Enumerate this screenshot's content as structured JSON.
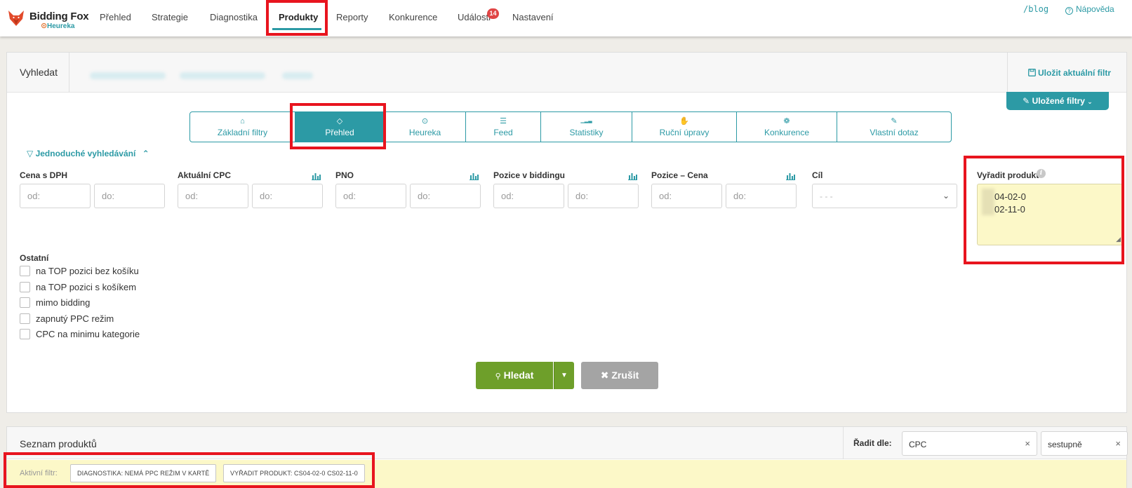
{
  "app": {
    "brand": "Bidding Fox",
    "brand_sub": "Heureka",
    "colors": {
      "accent": "#2c9aa5",
      "green": "#6e9f2a",
      "gray_button": "#a4a4a4",
      "badge": "#e04545",
      "highlight_yellow": "#fcf8c8",
      "annotation_red": "#e8141e"
    }
  },
  "nav": {
    "items": [
      {
        "label": "Přehled"
      },
      {
        "label": "Strategie"
      },
      {
        "label": "Diagnostika"
      },
      {
        "label": "Produkty",
        "active": true
      },
      {
        "label": "Reporty"
      },
      {
        "label": "Konkurence"
      },
      {
        "label": "Události",
        "badge": "14"
      },
      {
        "label": "Nastavení"
      }
    ],
    "blog_link": "/blog",
    "help_link": "Nápověda"
  },
  "search_panel": {
    "title": "Vyhledat",
    "save_filter": "Uložit aktuální filtr",
    "saved_filters": "Uložené filtry",
    "tabs": [
      {
        "label": "Základní filtry",
        "icon": "home-icon"
      },
      {
        "label": "Přehled",
        "icon": "shield-icon",
        "active": true
      },
      {
        "label": "Heureka",
        "icon": "heureka-search-icon"
      },
      {
        "label": "Feed",
        "icon": "list-icon"
      },
      {
        "label": "Statistiky",
        "icon": "bar-chart-icon"
      },
      {
        "label": "Ruční úpravy",
        "icon": "hand-icon"
      },
      {
        "label": "Konkurence",
        "icon": "users-icon"
      },
      {
        "label": "Vlastní dotaz",
        "icon": "pencil-icon"
      }
    ],
    "simple_search": "Jednoduché vyhledávání",
    "filters": [
      {
        "label": "Cena s DPH",
        "from": "od:",
        "to": "do:",
        "chart": false
      },
      {
        "label": "Aktuální CPC",
        "from": "od:",
        "to": "do:",
        "chart": true
      },
      {
        "label": "PNO",
        "from": "od:",
        "to": "do:",
        "chart": true
      },
      {
        "label": "Pozice v biddingu",
        "from": "od:",
        "to": "do:",
        "chart": true
      },
      {
        "label": "Pozice – Cena",
        "from": "od:",
        "to": "do:",
        "chart": true
      }
    ],
    "goal": {
      "label": "Cíl",
      "value": "- - -"
    },
    "exclude": {
      "label": "Vyřadit produkt",
      "lines": [
        "04-02-0",
        "02-11-0"
      ]
    },
    "other": {
      "label": "Ostatní",
      "checkboxes": [
        "na TOP pozici bez košíku",
        "na TOP pozici s košíkem",
        "mimo bidding",
        "zapnutý PPC režim",
        "CPC na minimu kategorie"
      ]
    },
    "search_button": "Hledat",
    "cancel_button": "Zrušit"
  },
  "product_list": {
    "title": "Seznam produktů",
    "sort_label": "Řadit dle:",
    "sort_field": "CPC",
    "sort_order": "sestupně",
    "active_filter_label": "Aktivní filtr:",
    "active_filters": [
      "DIAGNOSTIKA: NEMÁ PPC REŽIM V KARTĚ",
      "VYŘADIT PRODUKT: CS04-02-0 CS02-11-0"
    ]
  }
}
